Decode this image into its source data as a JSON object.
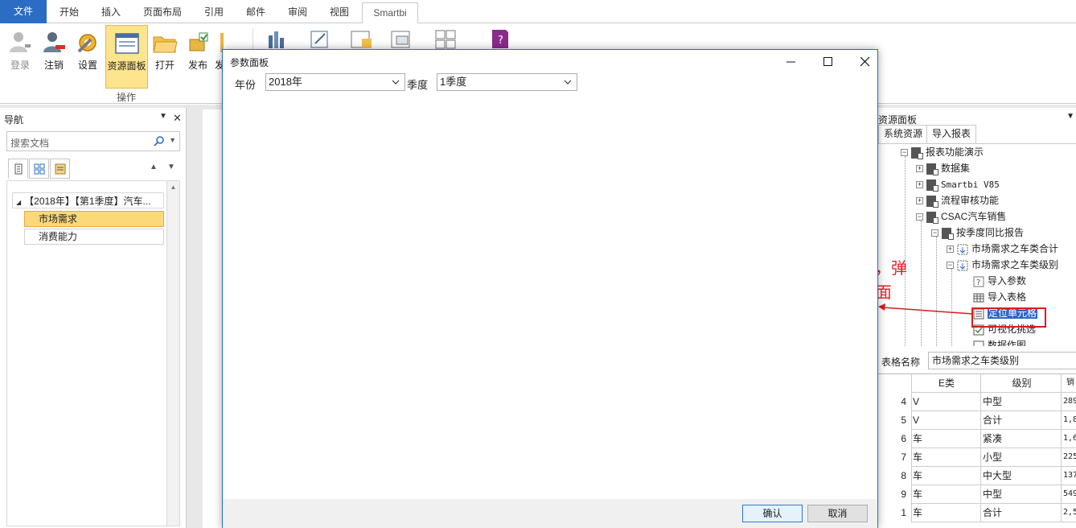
{
  "ribbon": {
    "tabs": [
      "文件",
      "开始",
      "插入",
      "页面布局",
      "引用",
      "邮件",
      "审阅",
      "视图",
      "Smartbi"
    ],
    "buttons": {
      "login": "登录",
      "logout": "注销",
      "settings": "设置",
      "resource_panel": "资源面板",
      "open": "打开",
      "publish": "发布",
      "publish_cut": "发"
    },
    "group_label": "操作"
  },
  "nav": {
    "title": "导航",
    "search_placeholder": "搜索文档",
    "head_item": "【2018年】【第1季度】汽车...",
    "items": [
      "市场需求",
      "消费能力"
    ]
  },
  "dialog": {
    "title": "参数面板",
    "year_label": "年份",
    "year_value": "2018年",
    "quarter_label": "季度",
    "quarter_value": "1季度",
    "ok": "确认",
    "cancel": "取消"
  },
  "annotation": {
    "line1": "双击定位单元格，弹",
    "line2": "出“参数面板”界面"
  },
  "resource_panel": {
    "title": "资源面板",
    "tabs": [
      "系统资源",
      "导入报表"
    ],
    "tree": [
      "报表功能演示",
      "数据集",
      "Smartbi V85",
      "流程审核功能",
      "CSAC汽车销售",
      "按季度同比报告",
      "市场需求之车类合计",
      "市场需求之车类级别",
      "导入参数",
      "导入表格",
      "定位单元格",
      "可视化挑选",
      "数据作图"
    ],
    "table_name_label": "表格名称",
    "table_name_value": "市场需求之车类级别",
    "grid_headers": [
      "E类",
      "级别",
      "销"
    ],
    "grid_rows": [
      {
        "n": "4",
        "c1": "V",
        "c2": "中型",
        "c3": "289"
      },
      {
        "n": "5",
        "c1": "V",
        "c2": "合计",
        "c3": "1,8"
      },
      {
        "n": "6",
        "c1": "车",
        "c2": "紧凑",
        "c3": "1,6"
      },
      {
        "n": "7",
        "c1": "车",
        "c2": "小型",
        "c3": "225"
      },
      {
        "n": "8",
        "c1": "车",
        "c2": "中大型",
        "c3": "137"
      },
      {
        "n": "9",
        "c1": "车",
        "c2": "中型",
        "c3": "549"
      },
      {
        "n": "1",
        "c1": "车",
        "c2": "合计",
        "c3": "2,5"
      }
    ]
  },
  "colors": {
    "file_tab": "#2b6cc4",
    "selected_fill": "#fde48e",
    "annotation": "#e51c23",
    "tree_highlight": "#2f64c8"
  }
}
